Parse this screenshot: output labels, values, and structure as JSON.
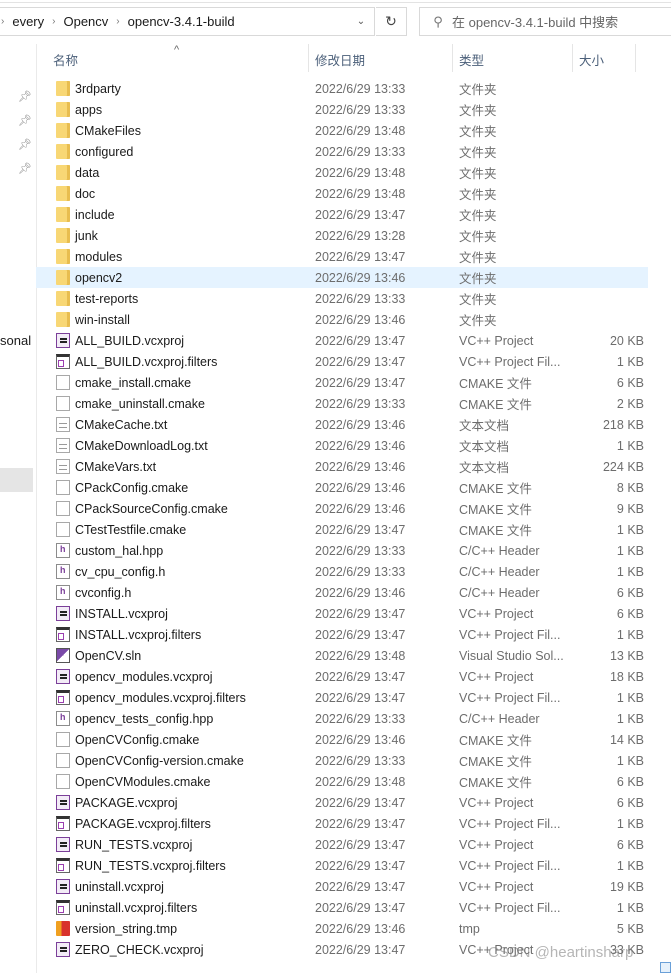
{
  "address_bar": {
    "breadcrumbs": [
      "every",
      "Opencv",
      "opencv-3.4.1-build"
    ],
    "dropdown_icon": "chevron-down-icon",
    "refresh_icon": "refresh-icon"
  },
  "search": {
    "placeholder": "在 opencv-3.4.1-build 中搜索",
    "icon": "search-icon"
  },
  "sidebar": {
    "pins": [
      "pin-icon",
      "pin-icon",
      "pin-icon",
      "pin-icon"
    ],
    "partial_label": "sonal"
  },
  "columns": {
    "name": "名称",
    "date": "修改日期",
    "type": "类型",
    "size": "大小",
    "sort_indicator": "^"
  },
  "files": [
    {
      "name": "3rdparty",
      "date": "2022/6/29 13:33",
      "type": "文件夹",
      "size": "",
      "icon": "folder"
    },
    {
      "name": "apps",
      "date": "2022/6/29 13:33",
      "type": "文件夹",
      "size": "",
      "icon": "folder"
    },
    {
      "name": "CMakeFiles",
      "date": "2022/6/29 13:48",
      "type": "文件夹",
      "size": "",
      "icon": "folder"
    },
    {
      "name": "configured",
      "date": "2022/6/29 13:33",
      "type": "文件夹",
      "size": "",
      "icon": "folder"
    },
    {
      "name": "data",
      "date": "2022/6/29 13:48",
      "type": "文件夹",
      "size": "",
      "icon": "folder"
    },
    {
      "name": "doc",
      "date": "2022/6/29 13:48",
      "type": "文件夹",
      "size": "",
      "icon": "folder"
    },
    {
      "name": "include",
      "date": "2022/6/29 13:47",
      "type": "文件夹",
      "size": "",
      "icon": "folder"
    },
    {
      "name": "junk",
      "date": "2022/6/29 13:28",
      "type": "文件夹",
      "size": "",
      "icon": "folder"
    },
    {
      "name": "modules",
      "date": "2022/6/29 13:47",
      "type": "文件夹",
      "size": "",
      "icon": "folder"
    },
    {
      "name": "opencv2",
      "date": "2022/6/29 13:46",
      "type": "文件夹",
      "size": "",
      "icon": "folder",
      "selected": true
    },
    {
      "name": "test-reports",
      "date": "2022/6/29 13:33",
      "type": "文件夹",
      "size": "",
      "icon": "folder"
    },
    {
      "name": "win-install",
      "date": "2022/6/29 13:46",
      "type": "文件夹",
      "size": "",
      "icon": "folder"
    },
    {
      "name": "ALL_BUILD.vcxproj",
      "date": "2022/6/29 13:47",
      "type": "VC++ Project",
      "size": "20 KB",
      "icon": "proj"
    },
    {
      "name": "ALL_BUILD.vcxproj.filters",
      "date": "2022/6/29 13:47",
      "type": "VC++ Project Fil...",
      "size": "1 KB",
      "icon": "filt"
    },
    {
      "name": "cmake_install.cmake",
      "date": "2022/6/29 13:47",
      "type": "CMAKE 文件",
      "size": "6 KB",
      "icon": "doc"
    },
    {
      "name": "cmake_uninstall.cmake",
      "date": "2022/6/29 13:33",
      "type": "CMAKE 文件",
      "size": "2 KB",
      "icon": "doc"
    },
    {
      "name": "CMakeCache.txt",
      "date": "2022/6/29 13:46",
      "type": "文本文档",
      "size": "218 KB",
      "icon": "txt"
    },
    {
      "name": "CMakeDownloadLog.txt",
      "date": "2022/6/29 13:46",
      "type": "文本文档",
      "size": "1 KB",
      "icon": "txt"
    },
    {
      "name": "CMakeVars.txt",
      "date": "2022/6/29 13:46",
      "type": "文本文档",
      "size": "224 KB",
      "icon": "txt"
    },
    {
      "name": "CPackConfig.cmake",
      "date": "2022/6/29 13:46",
      "type": "CMAKE 文件",
      "size": "8 KB",
      "icon": "doc"
    },
    {
      "name": "CPackSourceConfig.cmake",
      "date": "2022/6/29 13:46",
      "type": "CMAKE 文件",
      "size": "9 KB",
      "icon": "doc"
    },
    {
      "name": "CTestTestfile.cmake",
      "date": "2022/6/29 13:47",
      "type": "CMAKE 文件",
      "size": "1 KB",
      "icon": "doc"
    },
    {
      "name": "custom_hal.hpp",
      "date": "2022/6/29 13:33",
      "type": "C/C++ Header",
      "size": "1 KB",
      "icon": "hdr"
    },
    {
      "name": "cv_cpu_config.h",
      "date": "2022/6/29 13:33",
      "type": "C/C++ Header",
      "size": "1 KB",
      "icon": "hdr"
    },
    {
      "name": "cvconfig.h",
      "date": "2022/6/29 13:46",
      "type": "C/C++ Header",
      "size": "6 KB",
      "icon": "hdr"
    },
    {
      "name": "INSTALL.vcxproj",
      "date": "2022/6/29 13:47",
      "type": "VC++ Project",
      "size": "6 KB",
      "icon": "proj"
    },
    {
      "name": "INSTALL.vcxproj.filters",
      "date": "2022/6/29 13:47",
      "type": "VC++ Project Fil...",
      "size": "1 KB",
      "icon": "filt"
    },
    {
      "name": "OpenCV.sln",
      "date": "2022/6/29 13:48",
      "type": "Visual Studio Sol...",
      "size": "13 KB",
      "icon": "sln"
    },
    {
      "name": "opencv_modules.vcxproj",
      "date": "2022/6/29 13:47",
      "type": "VC++ Project",
      "size": "18 KB",
      "icon": "proj"
    },
    {
      "name": "opencv_modules.vcxproj.filters",
      "date": "2022/6/29 13:47",
      "type": "VC++ Project Fil...",
      "size": "1 KB",
      "icon": "filt"
    },
    {
      "name": "opencv_tests_config.hpp",
      "date": "2022/6/29 13:33",
      "type": "C/C++ Header",
      "size": "1 KB",
      "icon": "hdr"
    },
    {
      "name": "OpenCVConfig.cmake",
      "date": "2022/6/29 13:46",
      "type": "CMAKE 文件",
      "size": "14 KB",
      "icon": "doc"
    },
    {
      "name": "OpenCVConfig-version.cmake",
      "date": "2022/6/29 13:33",
      "type": "CMAKE 文件",
      "size": "1 KB",
      "icon": "doc"
    },
    {
      "name": "OpenCVModules.cmake",
      "date": "2022/6/29 13:48",
      "type": "CMAKE 文件",
      "size": "6 KB",
      "icon": "doc"
    },
    {
      "name": "PACKAGE.vcxproj",
      "date": "2022/6/29 13:47",
      "type": "VC++ Project",
      "size": "6 KB",
      "icon": "proj"
    },
    {
      "name": "PACKAGE.vcxproj.filters",
      "date": "2022/6/29 13:47",
      "type": "VC++ Project Fil...",
      "size": "1 KB",
      "icon": "filt"
    },
    {
      "name": "RUN_TESTS.vcxproj",
      "date": "2022/6/29 13:47",
      "type": "VC++ Project",
      "size": "6 KB",
      "icon": "proj"
    },
    {
      "name": "RUN_TESTS.vcxproj.filters",
      "date": "2022/6/29 13:47",
      "type": "VC++ Project Fil...",
      "size": "1 KB",
      "icon": "filt"
    },
    {
      "name": "uninstall.vcxproj",
      "date": "2022/6/29 13:47",
      "type": "VC++ Project",
      "size": "19 KB",
      "icon": "proj"
    },
    {
      "name": "uninstall.vcxproj.filters",
      "date": "2022/6/29 13:47",
      "type": "VC++ Project Fil...",
      "size": "1 KB",
      "icon": "filt"
    },
    {
      "name": "version_string.tmp",
      "date": "2022/6/29 13:46",
      "type": "tmp",
      "size": "5 KB",
      "icon": "tmp"
    },
    {
      "name": "ZERO_CHECK.vcxproj",
      "date": "2022/6/29 13:47",
      "type": "VC++ Project",
      "size": "33 KB",
      "icon": "proj"
    }
  ],
  "watermark": "CSDN @heartinsharp",
  "colors": {
    "selection": "#e5f3ff",
    "folder": "#f8d775",
    "header_text": "#4c607a",
    "secondary_text": "#6d6d6d"
  }
}
